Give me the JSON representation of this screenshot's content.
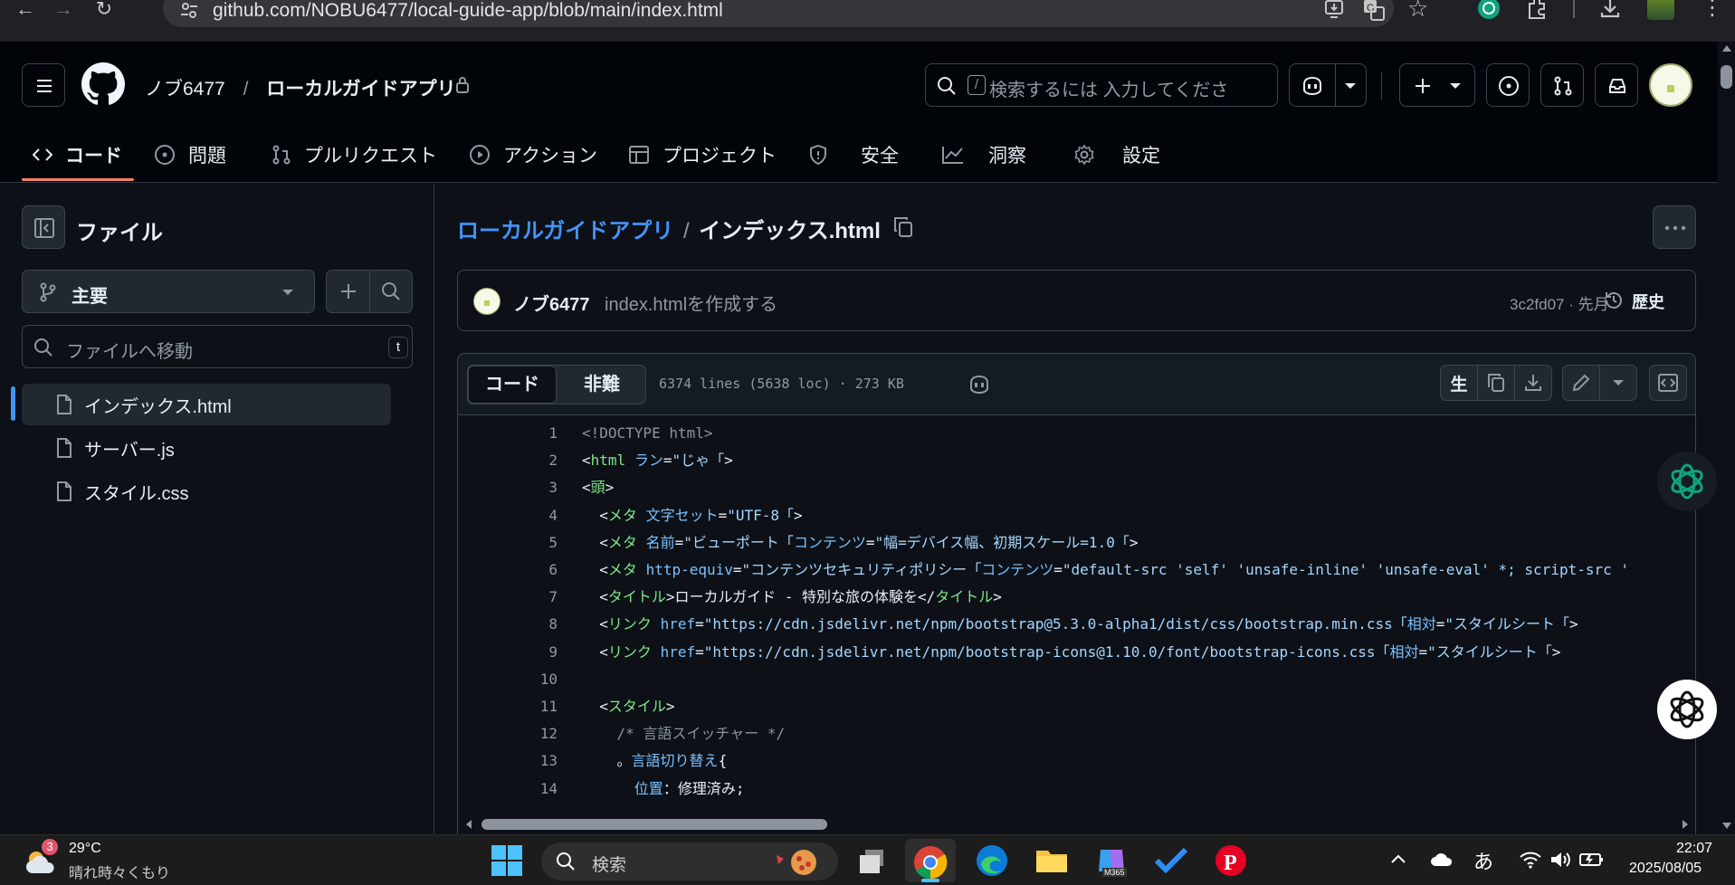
{
  "browser": {
    "url_host": "github.com",
    "url_path": "/NOBU6477/local-guide-app/blob/main/index.html"
  },
  "header": {
    "owner": "ノブ6477",
    "separator": "/",
    "repo": "ローカルガイドアプリ",
    "search": {
      "slash_key": "/",
      "placeholder": "検索するには 入力してくださ"
    }
  },
  "repo_nav": {
    "tabs": [
      {
        "label": "コード",
        "icon": "code-icon",
        "active": true
      },
      {
        "label": "問題",
        "icon": "issue-icon"
      },
      {
        "label": "プルリクエスト",
        "icon": "pull-request-icon"
      },
      {
        "label": "アクション",
        "icon": "play-icon"
      },
      {
        "label": "プロジェクト",
        "icon": "table-icon"
      },
      {
        "label": "安全",
        "icon": "shield-icon"
      },
      {
        "label": "洞察",
        "icon": "graph-icon"
      },
      {
        "label": "設定",
        "icon": "gear-icon"
      }
    ]
  },
  "sidebar": {
    "title": "ファイル",
    "branch": "主要",
    "goto_placeholder": "ファイルへ移動",
    "goto_shortcut": "t",
    "files": [
      {
        "name": "インデックス.html",
        "selected": true
      },
      {
        "name": "サーバー.js"
      },
      {
        "name": "スタイル.css"
      }
    ]
  },
  "file": {
    "breadcrumb_repo": "ローカルガイドアプリ",
    "breadcrumb_sep": "/",
    "breadcrumb_file": "インデックス.html",
    "commit": {
      "author": "ノブ6477",
      "message": "index.htmlを作成する",
      "meta": "3c2fd07 · 先月",
      "history_label": "歴史"
    },
    "tabs": {
      "code": "コード",
      "blame": "非難"
    },
    "stats": "6374 lines (5638 loc) · 273 KB",
    "raw_label": "生"
  },
  "code": {
    "lines": [
      {
        "n": "1",
        "segs": [
          [
            "c",
            "<!DOCTYPE html>"
          ]
        ]
      },
      {
        "n": "2",
        "segs": [
          [
            "p",
            "<"
          ],
          [
            "t",
            "html"
          ],
          [
            "p",
            " "
          ],
          [
            "a",
            "ラン"
          ],
          [
            "p",
            "="
          ],
          [
            "s",
            "\"じゃ「"
          ],
          [
            "p",
            ">"
          ]
        ]
      },
      {
        "n": "3",
        "segs": [
          [
            "p",
            "<"
          ],
          [
            "t",
            "頭"
          ],
          [
            "p",
            ">"
          ]
        ]
      },
      {
        "n": "4",
        "segs": [
          [
            "p",
            "  <"
          ],
          [
            "t",
            "メタ"
          ],
          [
            "p",
            " "
          ],
          [
            "a",
            "文字セット"
          ],
          [
            "p",
            "="
          ],
          [
            "s",
            "\"UTF-8「"
          ],
          [
            "p",
            ">"
          ]
        ]
      },
      {
        "n": "5",
        "segs": [
          [
            "p",
            "  <"
          ],
          [
            "t",
            "メタ"
          ],
          [
            "p",
            " "
          ],
          [
            "a",
            "名前"
          ],
          [
            "p",
            "="
          ],
          [
            "s",
            "\"ビューポート「"
          ],
          [
            "a",
            "コンテンツ"
          ],
          [
            "p",
            "="
          ],
          [
            "s",
            "\"幅=デバイス幅、初期スケール=1.0「"
          ],
          [
            "p",
            ">"
          ]
        ]
      },
      {
        "n": "6",
        "segs": [
          [
            "p",
            "  <"
          ],
          [
            "t",
            "メタ"
          ],
          [
            "p",
            " "
          ],
          [
            "a",
            "http-equiv"
          ],
          [
            "p",
            "="
          ],
          [
            "s",
            "\"コンテンツセキュリティポリシー「"
          ],
          [
            "a",
            "コンテンツ"
          ],
          [
            "p",
            "="
          ],
          [
            "s",
            "\"default-src 'self' 'unsafe-inline' 'unsafe-eval' *; script-src '"
          ]
        ]
      },
      {
        "n": "7",
        "segs": [
          [
            "p",
            "  <"
          ],
          [
            "t",
            "タイトル"
          ],
          [
            "p",
            ">ローカルガイド - 特別な旅の体験を</"
          ],
          [
            "t",
            "タイトル"
          ],
          [
            "p",
            ">"
          ]
        ]
      },
      {
        "n": "8",
        "segs": [
          [
            "p",
            "  <"
          ],
          [
            "t",
            "リンク"
          ],
          [
            "p",
            " "
          ],
          [
            "a",
            "href"
          ],
          [
            "p",
            "="
          ],
          [
            "s",
            "\"https://cdn.jsdelivr.net/npm/bootstrap@5.3.0-alpha1/dist/css/bootstrap.min.css「"
          ],
          [
            "a",
            "相対"
          ],
          [
            "p",
            "="
          ],
          [
            "s",
            "\"スタイルシート「"
          ],
          [
            "p",
            ">"
          ]
        ]
      },
      {
        "n": "9",
        "segs": [
          [
            "p",
            "  <"
          ],
          [
            "t",
            "リンク"
          ],
          [
            "p",
            " "
          ],
          [
            "a",
            "href"
          ],
          [
            "p",
            "="
          ],
          [
            "s",
            "\"https://cdn.jsdelivr.net/npm/bootstrap-icons@1.10.0/font/bootstrap-icons.css「"
          ],
          [
            "a",
            "相対"
          ],
          [
            "p",
            "="
          ],
          [
            "s",
            "\"スタイルシート「"
          ],
          [
            "p",
            ">"
          ]
        ]
      },
      {
        "n": "10",
        "segs": [
          [
            "p",
            ""
          ]
        ]
      },
      {
        "n": "11",
        "segs": [
          [
            "p",
            "  <"
          ],
          [
            "t",
            "スタイル"
          ],
          [
            "p",
            ">"
          ]
        ]
      },
      {
        "n": "12",
        "segs": [
          [
            "c",
            "    /* 言語スイッチャー */"
          ]
        ]
      },
      {
        "n": "13",
        "segs": [
          [
            "p",
            "    。"
          ],
          [
            "a",
            "言語切り替え"
          ],
          [
            "p",
            "{"
          ]
        ]
      },
      {
        "n": "14",
        "segs": [
          [
            "p",
            "      "
          ],
          [
            "a",
            "位置"
          ],
          [
            "p",
            "：修理済み;"
          ]
        ]
      }
    ]
  },
  "taskbar": {
    "weather_badge": "3",
    "temp": "29°C",
    "condition": "晴れ時々くもり",
    "search_placeholder": "検索",
    "ime": "あ",
    "time": "22:07",
    "date": "2025/08/05",
    "copilot_label": "M365"
  },
  "colors": {
    "accent_blue": "#4493f8",
    "active_tab_underline": "#f78166",
    "tag_green": "#7ee787",
    "attr_blue": "#79c0ff",
    "string_blue": "#a5d6ff"
  }
}
